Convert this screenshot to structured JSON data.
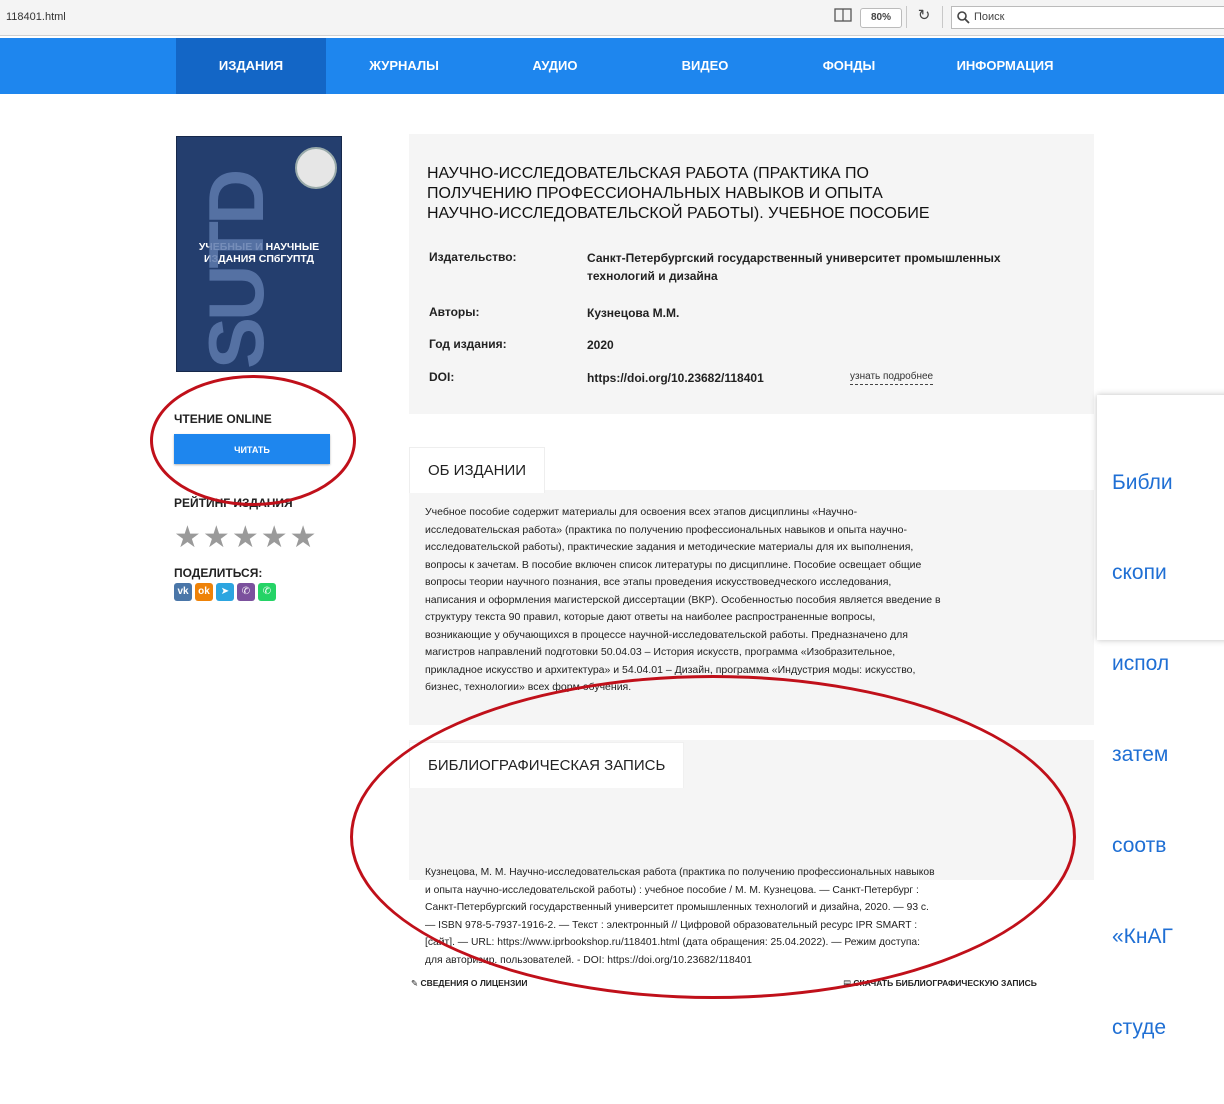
{
  "browser": {
    "url": "118401.html",
    "zoom": "80%",
    "search_placeholder": "Поиск"
  },
  "nav": {
    "items": [
      "ИЗДАНИЯ",
      "ЖУРНАЛЫ",
      "АУДИО",
      "ВИДЕО",
      "ФОНДЫ",
      "ИНФОРМАЦИЯ"
    ],
    "active": "ИЗДАНИЯ"
  },
  "cover": {
    "text_line1": "УЧЕБНЫЕ И НАУЧНЫЕ",
    "text_line2": "ИЗДАНИЯ СПбГУПТД",
    "big": "SUTD",
    "emblem_label": "СПбГУПТД"
  },
  "sidebar": {
    "read_online_label": "ЧТЕНИЕ ONLINE",
    "read_button": "ЧИТАТЬ",
    "rating_label": "РЕЙТИНГ ИЗДАНИЯ",
    "rating_stars": 5,
    "share_label": "ПОДЕЛИТЬСЯ:",
    "share_icons": [
      "vk",
      "ok",
      "telegram",
      "viber",
      "whatsapp"
    ]
  },
  "book": {
    "title_line1": "НАУЧНО-ИССЛЕДОВАТЕЛЬСКАЯ РАБОТА (ПРАКТИКА ПО",
    "title_line2": "ПОЛУЧЕНИЮ ПРОФЕССИОНАЛЬНЫХ НАВЫКОВ И ОПЫТА",
    "title_line3": "НАУЧНО-ИССЛЕДОВАТЕЛЬСКОЙ РАБОТЫ). УЧЕБНОЕ ПОСОБИЕ",
    "publisher_label": "Издательство:",
    "publisher_line1": "Санкт-Петербургский государственный университет промышленных",
    "publisher_line2": "технологий и дизайна",
    "authors_label": "Авторы:",
    "authors": "Кузнецова М.М.",
    "year_label": "Год издания:",
    "year": "2020",
    "doi_label": "DOI:",
    "doi": "https://doi.org/10.23682/118401",
    "more_link": "узнать подробнее"
  },
  "about": {
    "heading": "ОБ ИЗДАНИИ",
    "lines": [
      "Учебное пособие содержит материалы для освоения всех этапов дисциплины «Научно-",
      "исследовательская работа» (практика по получению профессиональных навыков и опыта научно-",
      "исследовательской работы), практические задания и методические материалы для их выполнения,",
      "вопросы к зачетам. В пособие включен список литературы по дисциплине. Пособие освещает общие",
      "вопросы теории научного познания, все этапы проведения искусствоведческого исследования,",
      "написания и оформления магистерской диссертации (ВКР). Особенностью пособия является введение в",
      "структуру текста 90 правил, которые дают ответы на наиболее распространенные вопросы,",
      "возникающие у обучающихся в процессе научной-исследовательской работы. Предназначено для",
      "магистров направлений подготовки 50.04.03 – История искусств, программа «Изобразительное,",
      "прикладное искусство и архитектура» и 54.04.01 – Дизайн, программа «Индустрия моды: искусство,",
      "бизнес, технологии» всех форм обучения."
    ]
  },
  "biblio": {
    "heading": "БИБЛИОГРАФИЧЕСКАЯ ЗАПИСЬ",
    "lines": [
      "Кузнецова, М. М. Научно-исследовательская работа (практика по получению профессиональных навыков",
      "и опыта научно-исследовательской работы) : учебное пособие / М. М. Кузнецова. — Санкт-Петербург :",
      "Санкт-Петербургский государственный университет промышленных технологий и дизайна, 2020. — 93 с.",
      "— ISBN 978-5-7937-1916-2. — Текст : электронный // Цифровой образовательный ресурс IPR SMART :",
      "[сайт]. — URL: https://www.iprbookshop.ru/118401.html (дата обращения: 25.04.2022). — Режим доступа:",
      "для авторизир. пользователей. - DOI: https://doi.org/10.23682/118401"
    ],
    "license_link": "СВЕДЕНИЯ О ЛИЦЕНЗИИ",
    "copy_link": "СКАЧАТЬ БИБЛИОГРАФИЧЕСКУЮ ЗАПИСЬ"
  },
  "tooltip": {
    "lines": [
      "Библи",
      "скопи",
      "испол",
      "затем",
      "соотв",
      "«КнАГ",
      "студе"
    ]
  },
  "colors": {
    "nav": "#1e86ee",
    "nav_active": "#1366c6",
    "annotation": "#c0101a",
    "tooltip_text": "#1f6fd4"
  }
}
